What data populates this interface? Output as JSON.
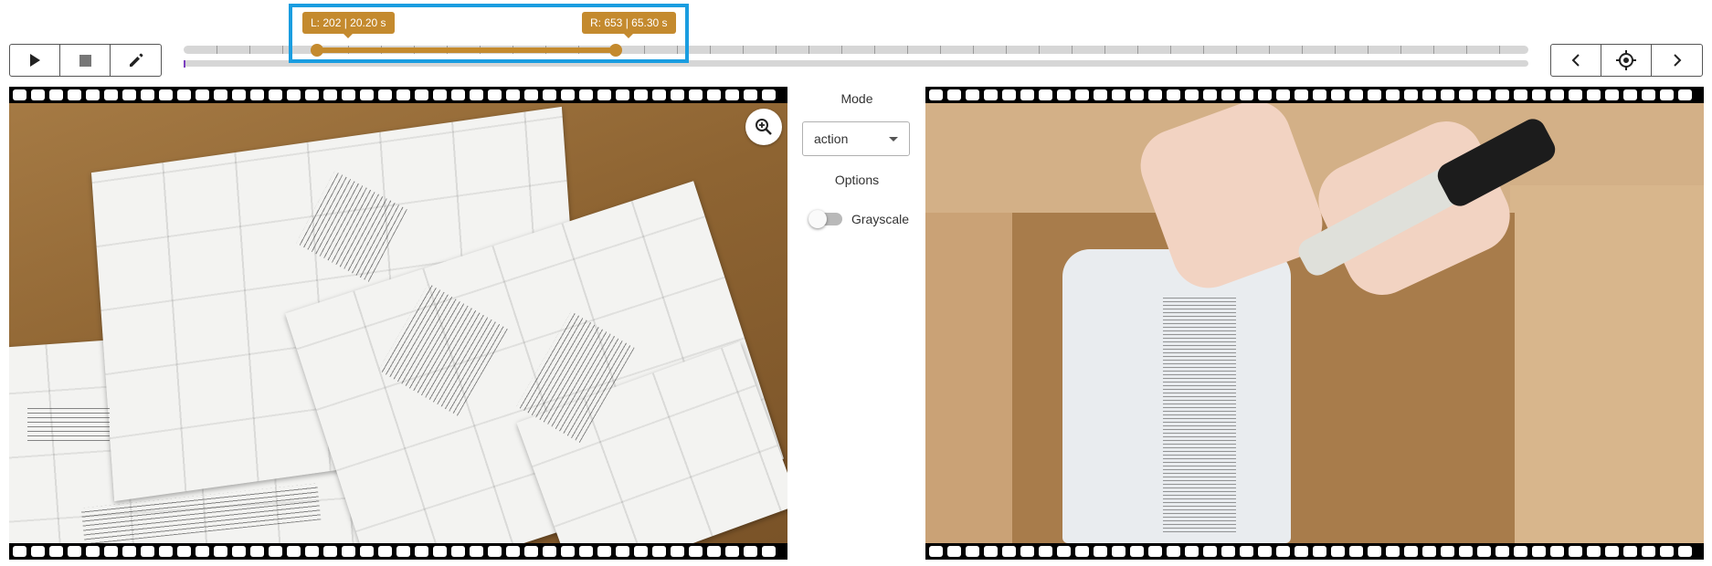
{
  "controls": {
    "left": [
      {
        "name": "play-button",
        "icon": "play-icon"
      },
      {
        "name": "stop-button",
        "icon": "stop-icon"
      },
      {
        "name": "edit-button",
        "icon": "pencil-icon"
      }
    ],
    "right": [
      {
        "name": "prev-button",
        "icon": "chevron-left-icon"
      },
      {
        "name": "center-button",
        "icon": "crosshair-icon"
      },
      {
        "name": "next-button",
        "icon": "chevron-right-icon"
      }
    ]
  },
  "timeline": {
    "left_label": "L: 202 | 20.20 s",
    "right_label": "R: 653 | 65.30 s",
    "left_frame": 202,
    "right_frame": 653,
    "accent_color": "#c48a2e",
    "highlight_color": "#1a9de0"
  },
  "side_panel": {
    "mode_label": "Mode",
    "mode_value": "action",
    "options_label": "Options",
    "grayscale_label": "Grayscale",
    "grayscale_on": false
  },
  "viewers": {
    "left_zoom_icon": "zoom-in-icon"
  }
}
